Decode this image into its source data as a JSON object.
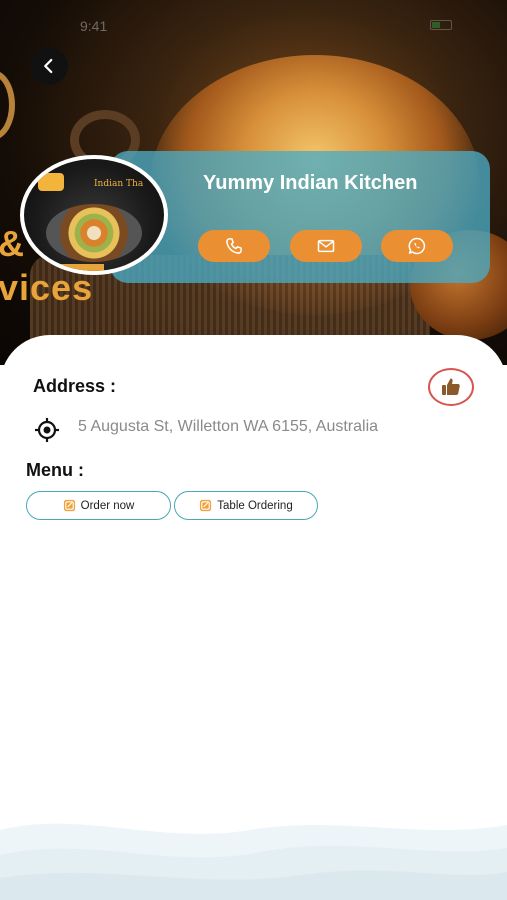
{
  "status_bar": {
    "time": "9:41"
  },
  "header": {
    "back_icon": "chevron-left-icon"
  },
  "restaurant": {
    "name": "Yummy Indian Kitchen",
    "logo_text": "Indian Tha",
    "actions": [
      {
        "label": "Call",
        "icon": "phone-icon"
      },
      {
        "label": "Email",
        "icon": "mail-icon"
      },
      {
        "label": "WhatsApp",
        "icon": "whatsapp-icon"
      }
    ],
    "accent_color": "#ea8f32",
    "card_color": "#4aaac4"
  },
  "hero_overlay_text": {
    "line1": "&",
    "line2": "vices"
  },
  "details": {
    "address_title": "Address :",
    "address": "5 Augusta St, Willetton WA 6155, Australia",
    "menu_title": "Menu :",
    "menu_options": [
      {
        "label": "Order now",
        "icon": "order-icon"
      },
      {
        "label": "Table Ordering",
        "icon": "order-icon"
      }
    ],
    "like_icon": "thumbs-up-icon",
    "like_color": "#d9534f"
  }
}
